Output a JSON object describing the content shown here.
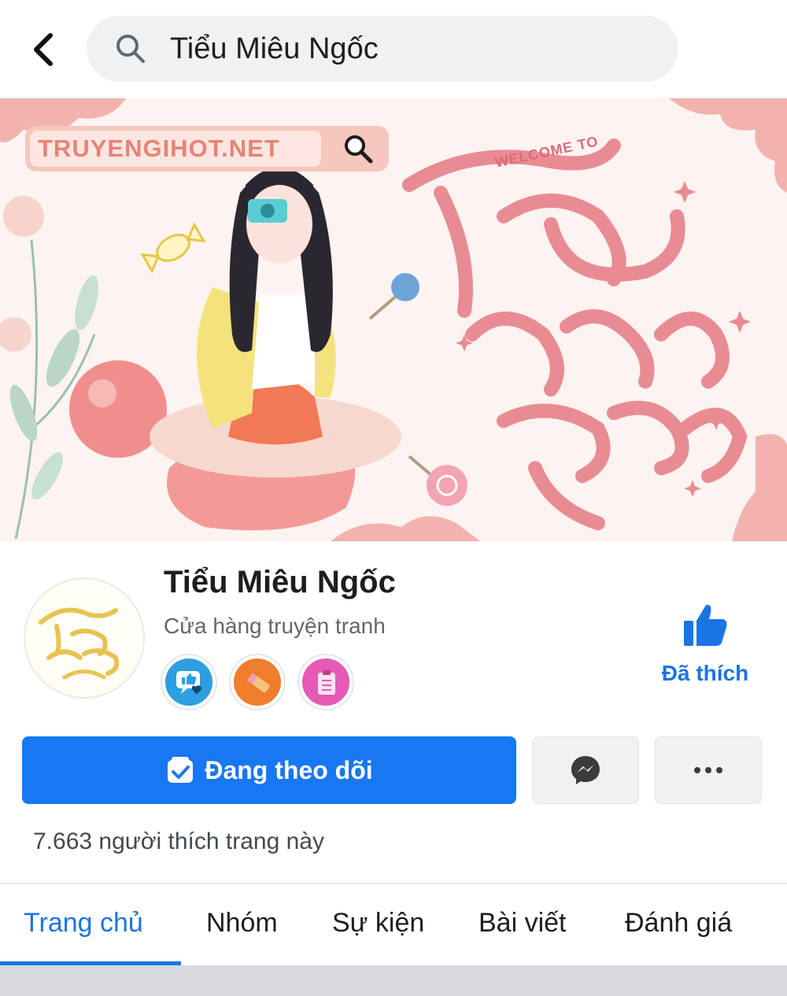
{
  "header": {
    "search_value": "Tiểu Miêu Ngốc"
  },
  "cover": {
    "brand_text": "TRUYENGIHOT.NET",
    "welcome_text": "WELCOME TO",
    "script_title_line1": "tiểu",
    "script_title_line2": "miêu",
    "script_title_line3": "ngốc"
  },
  "profile": {
    "name": "Tiểu Miêu Ngốc",
    "category": "Cửa hàng truyện tranh",
    "liked_label": "Đã thích",
    "avatar_text_line1": "tiểu",
    "avatar_text_line2": "miêu",
    "avatar_text_line3": "ngốc"
  },
  "actions": {
    "follow_label": "Đang theo dõi",
    "likes_count": "7.663 người thích trang này"
  },
  "tabs": [
    {
      "label": "Trang chủ",
      "active": true
    },
    {
      "label": "Nhóm",
      "active": false
    },
    {
      "label": "Sự kiện",
      "active": false
    },
    {
      "label": "Bài viết",
      "active": false
    },
    {
      "label": "Đánh giá",
      "active": false
    }
  ],
  "colors": {
    "accent": "#1877f2",
    "active_tab": "#1b74e4",
    "cover_pink": "#e9838c"
  }
}
